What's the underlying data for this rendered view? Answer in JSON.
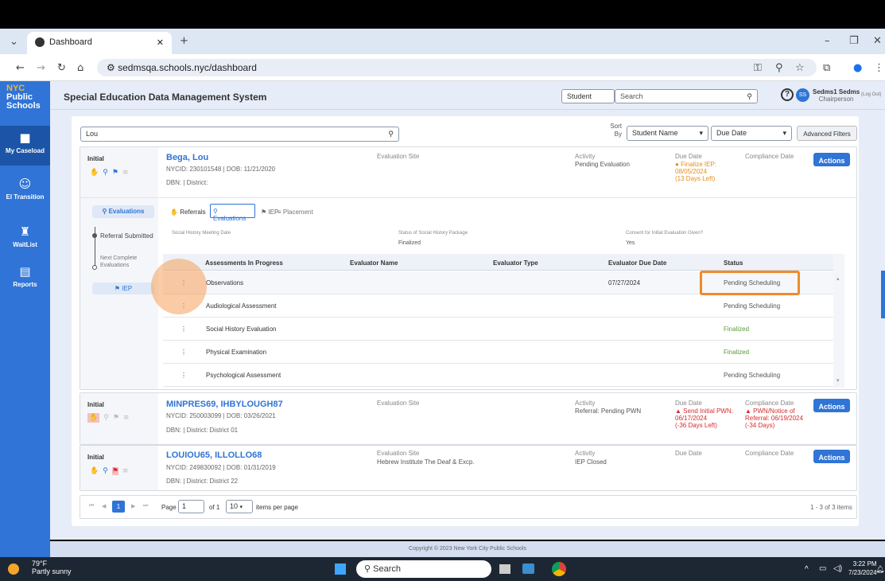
{
  "browser": {
    "tab_title": "Dashboard",
    "url": "sedmsqa.schools.nyc/dashboard"
  },
  "sidebar": {
    "logo": [
      "NYC",
      "Public",
      "Schools"
    ],
    "items": [
      {
        "label": "My Caseload",
        "icon": "briefcase-icon"
      },
      {
        "label": "EI Transition",
        "icon": "people-icon"
      },
      {
        "label": "WaitList",
        "icon": "chair-icon"
      },
      {
        "label": "Reports",
        "icon": "document-icon"
      }
    ]
  },
  "header": {
    "title": "Special Education Data Management System",
    "search_type": "Student",
    "search_placeholder": "Search",
    "user_initials": "SS",
    "user_name": "Sedms1 Sedms",
    "user_role": "Chairperson",
    "logout": "(Log Out)"
  },
  "filters": {
    "search_value": "Lou",
    "sort_label": "Sort By",
    "sort_value": "Student Name",
    "due_value": "Due Date",
    "advanced": "Advanced Filters"
  },
  "students": [
    {
      "phase": "Initial",
      "name": "Bega, Lou",
      "ids": "NYCID: 230101548 | DOB: 11/21/2020",
      "dbn": "DBN: | District:",
      "site_label": "Evaluation Site",
      "site": "",
      "activity_label": "Activity",
      "activity": "Pending Evaluation",
      "due_label": "Due Date",
      "due": [
        "Finalize IEP:",
        "08/05/2024",
        "(13 Days Left)"
      ],
      "compliance_label": "Compliance Date",
      "compliance": [],
      "actions": "Actions"
    },
    {
      "phase": "Initial",
      "name": "MINPRES69, IHBYLOUGH87",
      "ids": "NYCID: 250003099 | DOB: 03/26/2021",
      "dbn": "DBN: | District: District 01",
      "site_label": "Evaluation Site",
      "site": "",
      "activity_label": "Activity",
      "activity": "Referral: Pending PWN",
      "due_label": "Due Date",
      "due": [
        "Send Initial PWN:",
        "06/17/2024",
        "(-36 Days Left)"
      ],
      "compliance_label": "Compliance Date",
      "compliance": [
        "PWN/Notice of",
        "Referral: 06/19/2024",
        "(-34 Days)"
      ],
      "actions": "Actions"
    },
    {
      "phase": "Initial",
      "name": "LOUIOU65, ILLOLLO68",
      "ids": "NYCID: 249830092 | DOB: 01/31/2019",
      "dbn": "DBN: | District: District 22",
      "site_label": "Evaluation Site",
      "site": "Hebrew Institute The Deaf & Excp.",
      "activity_label": "Activity",
      "activity": "IEP Closed",
      "due_label": "Due Date",
      "due": [],
      "compliance_label": "Compliance Date",
      "compliance": [],
      "actions": "Actions"
    }
  ],
  "detail": {
    "left_evaluations": "Evaluations",
    "steps": [
      {
        "label": "Referral Submitted"
      },
      {
        "label": "Next Complete Evaluations"
      }
    ],
    "iep_button": "IEP",
    "tabs": [
      "Referrals",
      "Evaluations",
      "IEP",
      "Placement"
    ],
    "social_history_label": "Social History Meeting Date",
    "status_pkg_label": "Status of Social History Package",
    "status_pkg": "Finalized",
    "consent_label": "Consent for Initial Evaluation Given?",
    "consent": "Yes",
    "columns": [
      "Assessments In Progress",
      "Evaluator Name",
      "Evaluator Type",
      "Evaluator Due Date",
      "Status"
    ],
    "rows": [
      {
        "assessment": "Observations",
        "due": "07/27/2024",
        "status": "Pending Scheduling"
      },
      {
        "assessment": "Audiological Assessment",
        "due": "",
        "status": "Pending Scheduling"
      },
      {
        "assessment": "Social History Evaluation",
        "due": "",
        "status": "Finalized"
      },
      {
        "assessment": "Physical Examination",
        "due": "",
        "status": "Finalized"
      },
      {
        "assessment": "Psychological Assessment",
        "due": "",
        "status": "Pending Scheduling"
      }
    ]
  },
  "pagination": {
    "page_label": "Page",
    "page": "1",
    "of": "of 1",
    "per_page": "10",
    "per_page_label": "items per page",
    "summary": "1 - 3 of 3 items"
  },
  "footer": "Copyright © 2023 New York City Public Schools",
  "taskbar": {
    "weather_temp": "79°F",
    "weather_desc": "Partly sunny",
    "search": "Search",
    "time": "3:22 PM",
    "date": "7/23/2024"
  }
}
